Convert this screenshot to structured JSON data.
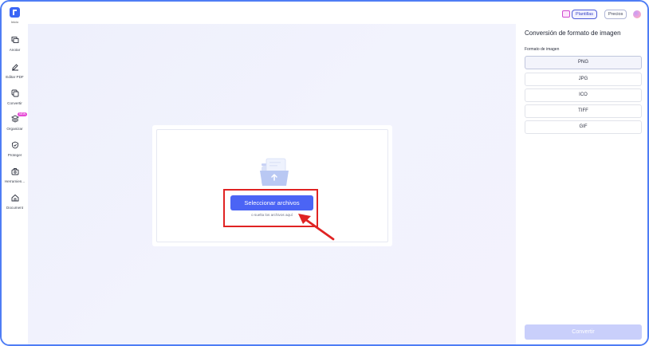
{
  "sidebar": {
    "logo_label": "Inicio",
    "items": [
      {
        "label": "Anotar",
        "icon": "annotate-icon"
      },
      {
        "label": "Editar PDF",
        "icon": "edit-pdf-icon"
      },
      {
        "label": "Convertir",
        "icon": "convert-icon"
      },
      {
        "label": "Organizar",
        "icon": "organize-icon",
        "badge": "NEW"
      },
      {
        "label": "Proteger",
        "icon": "protect-icon"
      },
      {
        "label": "Herramien...",
        "icon": "tools-icon"
      },
      {
        "label": "Document",
        "icon": "home-icon"
      }
    ]
  },
  "topbar": {
    "plantillas_label": "Plantillas",
    "precios_label": "Precios"
  },
  "upload": {
    "select_label": "Seleccionar archivos",
    "drop_text": "o suelta los archivos aquí"
  },
  "panel": {
    "title": "Conversión de formato de imagen",
    "subtitle": "Formato de imagen",
    "options": [
      "PNG",
      "JPG",
      "ICO",
      "TIFF",
      "GIF"
    ],
    "selected": "PNG",
    "convert_label": "Convertir"
  },
  "colors": {
    "accent": "#4b64f5",
    "highlight": "#e02323",
    "frame": "#4e7df5"
  }
}
